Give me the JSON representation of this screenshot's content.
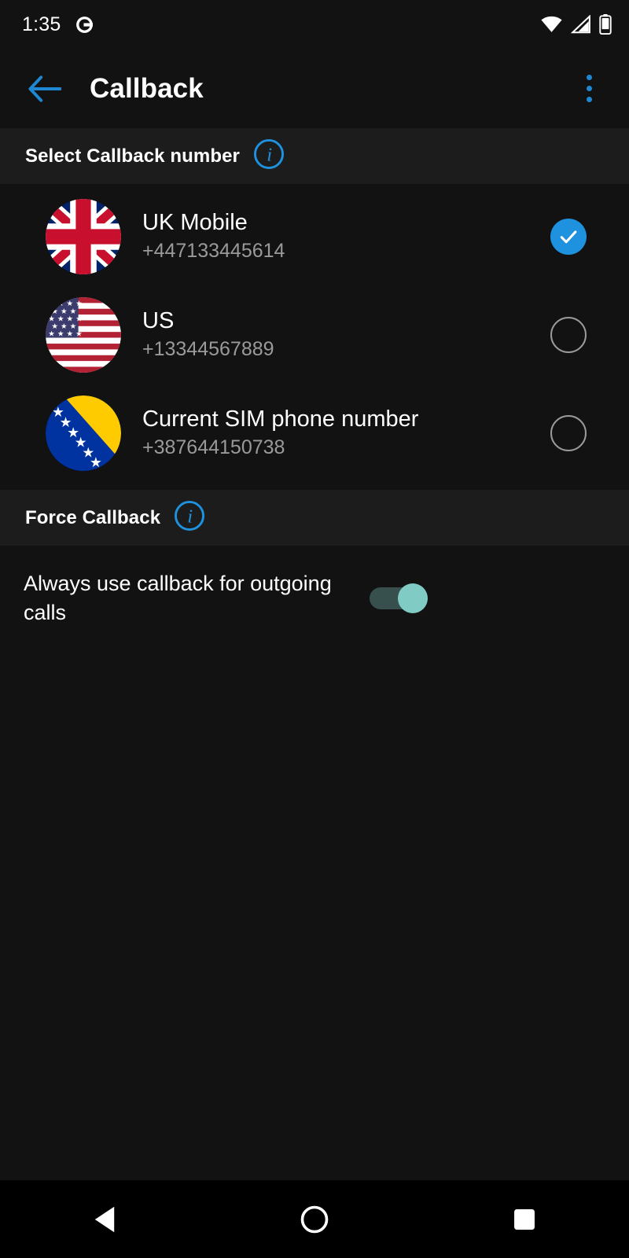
{
  "status_bar": {
    "time": "1:35",
    "notification_icon": "notification-badge-icon",
    "wifi_icon": "wifi-full-icon",
    "signal_icon": "cell-signal-icon",
    "battery_icon": "battery-icon"
  },
  "app_bar": {
    "back_icon": "back-arrow-icon",
    "title": "Callback",
    "overflow_icon": "overflow-menu-icon"
  },
  "sections": {
    "select_number": {
      "title": "Select Callback number",
      "info_icon": "info-icon"
    },
    "force_callback": {
      "title": "Force Callback",
      "info_icon": "info-icon"
    }
  },
  "numbers": [
    {
      "label": "UK Mobile",
      "number": "+447133445614",
      "flag": "flag-uk",
      "selected": true
    },
    {
      "label": "US",
      "number": "+13344567889",
      "flag": "flag-us",
      "selected": false
    },
    {
      "label": "Current SIM phone number",
      "number": "+387644150738",
      "flag": "flag-bosnia",
      "selected": false
    }
  ],
  "force_callback": {
    "toggle_label": "Always use callback for outgoing calls",
    "toggle_state": "on"
  },
  "nav_bar": {
    "back_icon": "nav-back-icon",
    "home_icon": "nav-home-icon",
    "recents_icon": "nav-recents-icon"
  },
  "colors": {
    "accent_blue": "#1e92de",
    "background": "#121212",
    "section_header_bg": "#1c1c1c",
    "toggle_thumb": "#80cbc4",
    "toggle_track": "#37504e",
    "secondary_text": "#9a9a9a"
  }
}
